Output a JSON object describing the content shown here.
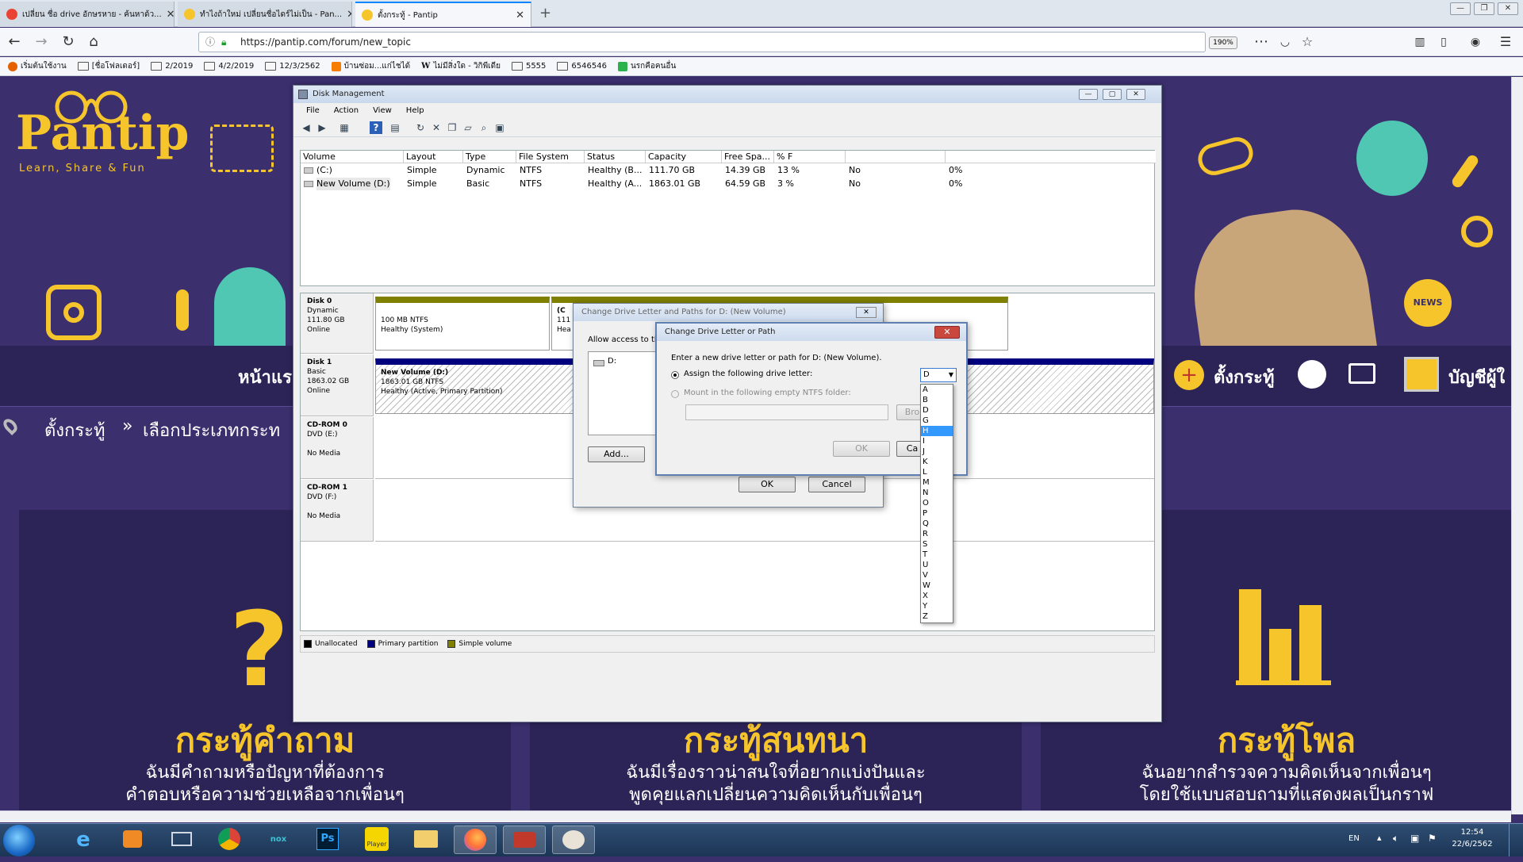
{
  "browser": {
    "tabs": [
      {
        "title": "เปลี่ยน ชื่อ drive อักษรหาย - ค้นหาด้ว...",
        "favicon_color": "#ea4335"
      },
      {
        "title": "ทำไงถ้าใหม่ เปลี่ยนชื่อไดร์ไม่เป็น - Pan...",
        "favicon_color": "#f6c52b"
      },
      {
        "title": "ตั้งกระทู้ - Pantip",
        "favicon_color": "#f6c52b"
      }
    ],
    "new_tab": "+",
    "url": "https://pantip.com/forum/new_topic",
    "zoom": "190%",
    "bookmarks": [
      {
        "label": "เริ่มต้นใช้งาน",
        "icon": "firefox-icon"
      },
      {
        "label": "[ชื่อโฟลเดอร์]",
        "icon": "folder-icon"
      },
      {
        "label": "2/2019",
        "icon": "folder-icon"
      },
      {
        "label": "4/2/2019",
        "icon": "folder-icon"
      },
      {
        "label": "12/3/2562",
        "icon": "folder-icon"
      },
      {
        "label": "บ้านซ่อม...แก่ไชได้",
        "icon": "blogger-icon"
      },
      {
        "label": "ไม่มีสิ่งใด - วิกิพีเดีย",
        "icon": "wikipedia-icon"
      },
      {
        "label": "5555",
        "icon": "folder-icon"
      },
      {
        "label": "6546546",
        "icon": "folder-icon"
      },
      {
        "label": "นรกคือคนอื่น",
        "icon": "leaf-icon"
      }
    ]
  },
  "pantip": {
    "logo": "Pantip",
    "tagline": "Learn, Share & Fun",
    "news_badge": "NEWS",
    "nav_home": "หน้าแร",
    "nav_post": "ตั้งกระทู้",
    "nav_account": "บัญชีผู้ใ",
    "breadcrumb_1": "ตั้งกระทู้",
    "breadcrumb_sep": "»",
    "breadcrumb_2": "เลือกประเภทกระท",
    "cards": [
      {
        "title": "กระทู้คำถาม",
        "desc1": "ฉันมีคำถามหรือปัญหาที่ต้องการ",
        "desc2": "คำตอบหรือความช่วยเหลือจากเพื่อนๆ"
      },
      {
        "title": "กระทู้สนทนา",
        "desc1": "ฉันมีเรื่องราวน่าสนใจที่อยากแบ่งปันและ",
        "desc2": "พูดคุยแลกเปลี่ยนความคิดเห็นกับเพื่อนๆ"
      },
      {
        "title": "กระทู้โพล",
        "desc1": "ฉันอยากสำรวจความคิดเห็นจากเพื่อนๆ",
        "desc2": "โดยใช้แบบสอบถามที่แสดงผลเป็นกราฟ"
      }
    ]
  },
  "disk_management": {
    "title": "Disk Management",
    "menu": [
      "File",
      "Action",
      "View",
      "Help"
    ],
    "columns": [
      "Volume",
      "Layout",
      "Type",
      "File System",
      "Status",
      "Capacity",
      "Free Spa...",
      "% F",
      "",
      ""
    ],
    "rows": [
      {
        "volume": "(C:)",
        "layout": "Simple",
        "type": "Dynamic",
        "fs": "NTFS",
        "status": "Healthy (B...",
        "capacity": "111.70 GB",
        "free": "14.39 GB",
        "pct": "13 %",
        "c9": "No",
        "c10": "0%"
      },
      {
        "volume": "New Volume (D:)",
        "layout": "Simple",
        "type": "Basic",
        "fs": "NTFS",
        "status": "Healthy (A...",
        "capacity": "1863.01 GB",
        "free": "64.59 GB",
        "pct": "3 %",
        "c9": "No",
        "c10": "0%"
      }
    ],
    "disks": [
      {
        "name": "Disk 0",
        "l1": "Dynamic",
        "l2": "111.80 GB",
        "l3": "Online"
      },
      {
        "name": "Disk 1",
        "l1": "Basic",
        "l2": "1863.02 GB",
        "l3": "Online"
      },
      {
        "name": "CD-ROM 0",
        "l1": "DVD (E:)",
        "l2": "",
        "l3": "No Media"
      },
      {
        "name": "CD-ROM 1",
        "l1": "DVD (F:)",
        "l2": "",
        "l3": "No Media"
      }
    ],
    "disk0_part1": {
      "l1": "100 MB NTFS",
      "l2": "Healthy (System)"
    },
    "disk0_part2": {
      "l1": "(C",
      "l2": "111",
      "l3": "Hea"
    },
    "disk1_part": {
      "name": "New Volume  (D:)",
      "l1": "1863.01 GB NTFS",
      "l2": "Healthy (Active, Primary Partition)"
    },
    "legend": [
      {
        "label": "Unallocated",
        "color": "#000000"
      },
      {
        "label": "Primary partition",
        "color": "#00007f"
      },
      {
        "label": "Simple volume",
        "color": "#7f7f00"
      }
    ]
  },
  "dialog_paths": {
    "title": "Change Drive Letter and Paths for D: (New Volume)",
    "allow_text": "Allow access to thi",
    "list_item": "D:",
    "add": "Add...",
    "ok": "OK",
    "cancel": "Cancel"
  },
  "dialog_letter": {
    "title": "Change Drive Letter or Path",
    "prompt": "Enter a new drive letter or path for D: (New Volume).",
    "opt_assign": "Assign the following drive letter:",
    "opt_mount": "Mount in the following empty NTFS folder:",
    "browse": "Bro",
    "ok": "OK",
    "cancel": "Ca",
    "selected": "D",
    "options": [
      "A",
      "B",
      "D",
      "G",
      "H",
      "I",
      "J",
      "K",
      "L",
      "M",
      "N",
      "O",
      "P",
      "Q",
      "R",
      "S",
      "T",
      "U",
      "V",
      "W",
      "X",
      "Y",
      "Z"
    ],
    "highlighted": "H"
  },
  "taskbar": {
    "apps": [
      "ie-icon",
      "media-player-icon",
      "network-icon",
      "chrome-icon",
      "nox-icon",
      "photoshop-icon",
      "player-icon",
      "explorer-icon",
      "firefox-icon",
      "toolbox-icon",
      "paint-icon"
    ],
    "ps_label": "Ps",
    "nox_label": "nox",
    "player_label": "Player",
    "lang": "EN",
    "time": "12:54",
    "date": "22/6/2562"
  }
}
